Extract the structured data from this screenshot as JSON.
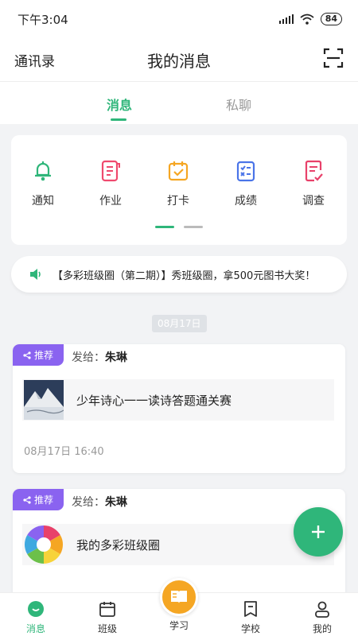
{
  "status_bar": {
    "time": "下午3:04",
    "battery": "84"
  },
  "header": {
    "left_link": "通讯录",
    "title": "我的消息"
  },
  "tabs": [
    {
      "label": "消息"
    },
    {
      "label": "私聊"
    }
  ],
  "categories": [
    {
      "label": "通知",
      "icon": "bell-icon"
    },
    {
      "label": "作业",
      "icon": "homework-icon"
    },
    {
      "label": "打卡",
      "icon": "checkin-icon"
    },
    {
      "label": "成绩",
      "icon": "grades-icon"
    },
    {
      "label": "调查",
      "icon": "survey-icon"
    }
  ],
  "notice": {
    "text": "【多彩班级圈（第二期）】秀班级圈，拿500元图书大奖！"
  },
  "date_chip": "08月17日",
  "messages": [
    {
      "badge": "推荐",
      "send_prefix": "发给：",
      "recipient": "朱琳",
      "title": "少年诗心一一读诗答题通关赛",
      "time": "08月17日 16:40"
    },
    {
      "badge": "推荐",
      "send_prefix": "发给：",
      "recipient": "朱琳",
      "title": "我的多彩班级圈"
    }
  ],
  "bottom_nav": [
    {
      "label": "消息"
    },
    {
      "label": "班级"
    },
    {
      "label": "学习"
    },
    {
      "label": "学校"
    },
    {
      "label": "我的"
    }
  ],
  "colors": {
    "accent": "#2fb67a",
    "badge": "#8a63f0",
    "center": "#f5a623"
  }
}
